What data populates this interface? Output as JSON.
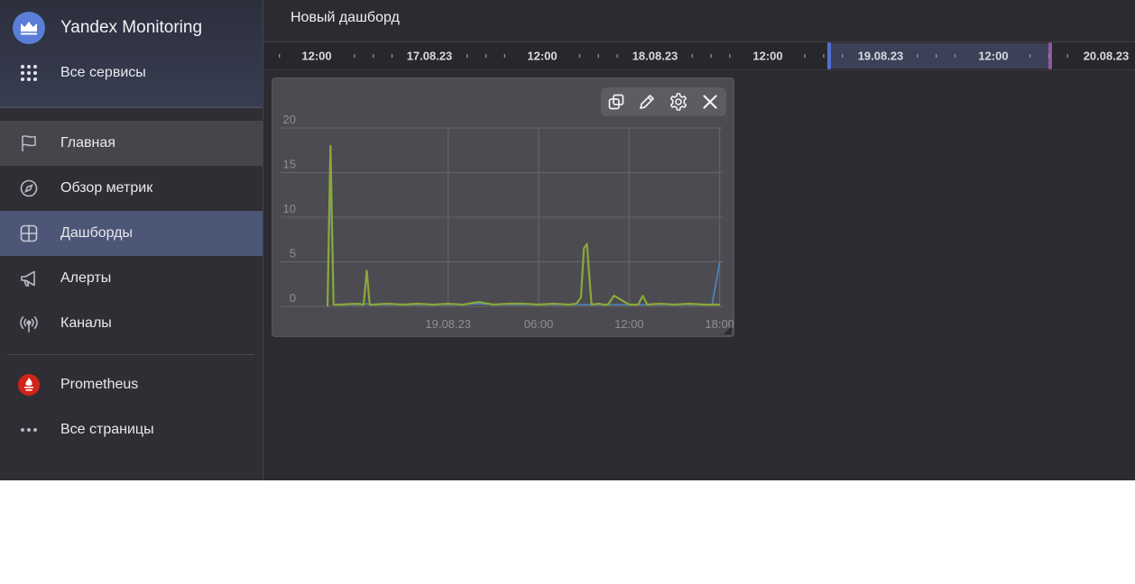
{
  "sidebar": {
    "brand": "Yandex Monitoring",
    "all_services": "Все сервисы",
    "items": [
      {
        "label": "Главная",
        "icon": "flag-icon"
      },
      {
        "label": "Обзор метрик",
        "icon": "compass-icon"
      },
      {
        "label": "Дашборды",
        "icon": "dashboard-grid-icon"
      },
      {
        "label": "Алерты",
        "icon": "megaphone-icon"
      },
      {
        "label": "Каналы",
        "icon": "broadcast-icon"
      }
    ],
    "prometheus": "Prometheus",
    "all_pages": "Все страницы",
    "active_item": "Дашборды"
  },
  "header": {
    "title": "Новый дашборд"
  },
  "timeline": {
    "labels": [
      "12:00",
      "17.08.23",
      "12:00",
      "18.08.23",
      "12:00",
      "19.08.23",
      "12:00",
      "20.08.23"
    ],
    "selection_color": "#3c4158",
    "handle_left_color": "#4f6fd4",
    "handle_right_color": "#8a5a9e"
  },
  "widget": {
    "toolbar": [
      "copy-icon",
      "pencil-icon",
      "gear-icon",
      "close-icon"
    ]
  },
  "chart_data": {
    "type": "line",
    "title": "",
    "xlabel": "",
    "ylabel": "",
    "ylim": [
      0,
      20
    ],
    "yticks": [
      0,
      5,
      10,
      15,
      20
    ],
    "xticks": [
      "19.08.23",
      "06:00",
      "12:00",
      "18:00"
    ],
    "grid": true,
    "legend": "none",
    "x_hours": [
      -8,
      -7.8,
      -7.6,
      -7.2,
      -6,
      -5.6,
      -5.4,
      -5.2,
      -5,
      -4,
      -3,
      -2,
      -1,
      0,
      1,
      2,
      3,
      4,
      5,
      6,
      7,
      8,
      8.5,
      8.8,
      9,
      9.2,
      9.5,
      10,
      10.3,
      10.6,
      11,
      12,
      12.6,
      12.9,
      13.2,
      14,
      15,
      16,
      17,
      17.5,
      18
    ],
    "series": [
      {
        "color": "#8aa839",
        "values": [
          0,
          18,
          0.2,
          0.2,
          0.3,
          0.2,
          4,
          0.2,
          0.2,
          0.3,
          0.2,
          0.3,
          0.2,
          0.3,
          0.2,
          0.5,
          0.2,
          0.3,
          0.3,
          0.2,
          0.3,
          0.2,
          0.3,
          1,
          6.5,
          7,
          0.2,
          0.3,
          0.2,
          0.2,
          1.2,
          0.2,
          0.2,
          1.2,
          0.2,
          0.3,
          0.2,
          0.3,
          0.2,
          0.2,
          0.2
        ]
      },
      {
        "color": "#4a86c5",
        "values": [
          0,
          14.5,
          0.2,
          0.2,
          0.2,
          0.2,
          0.3,
          0.2,
          0.2,
          0.2,
          0.2,
          0.2,
          0.2,
          0.2,
          0.2,
          0.3,
          0.2,
          0.2,
          0.2,
          0.2,
          0.2,
          0.2,
          0.2,
          0.2,
          0.2,
          0.2,
          0.2,
          0.2,
          0.2,
          0.2,
          0.2,
          0.2,
          0.2,
          0.2,
          0.2,
          0.2,
          0.2,
          0.2,
          0.2,
          0.2,
          5
        ]
      }
    ]
  }
}
